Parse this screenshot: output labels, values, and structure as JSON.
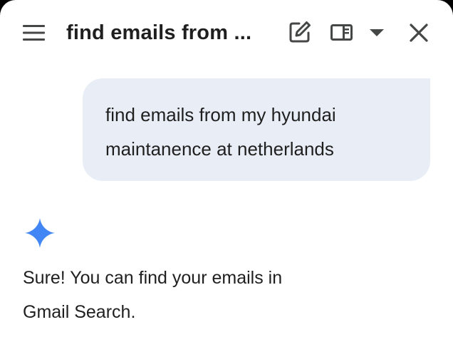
{
  "header": {
    "title": "find emails from ...",
    "icons": {
      "menu": "menu-icon",
      "compose": "edit-icon",
      "panel": "side-panel-icon",
      "dropdown": "caret-down-icon",
      "close": "close-icon"
    }
  },
  "conversation": {
    "user_message": {
      "lines": [
        "find emails from my hyundai",
        "maintanence at netherlands"
      ]
    },
    "assistant_message": {
      "icon": "gemini-sparkle-icon",
      "lines": [
        "Sure! You can find your emails in",
        "Gmail Search."
      ]
    }
  },
  "colors": {
    "background": "#ffffff",
    "bubble": "#e9eef6",
    "text": "#1f1f1f",
    "icon": "#444746",
    "sparkle": "#4285f4"
  }
}
